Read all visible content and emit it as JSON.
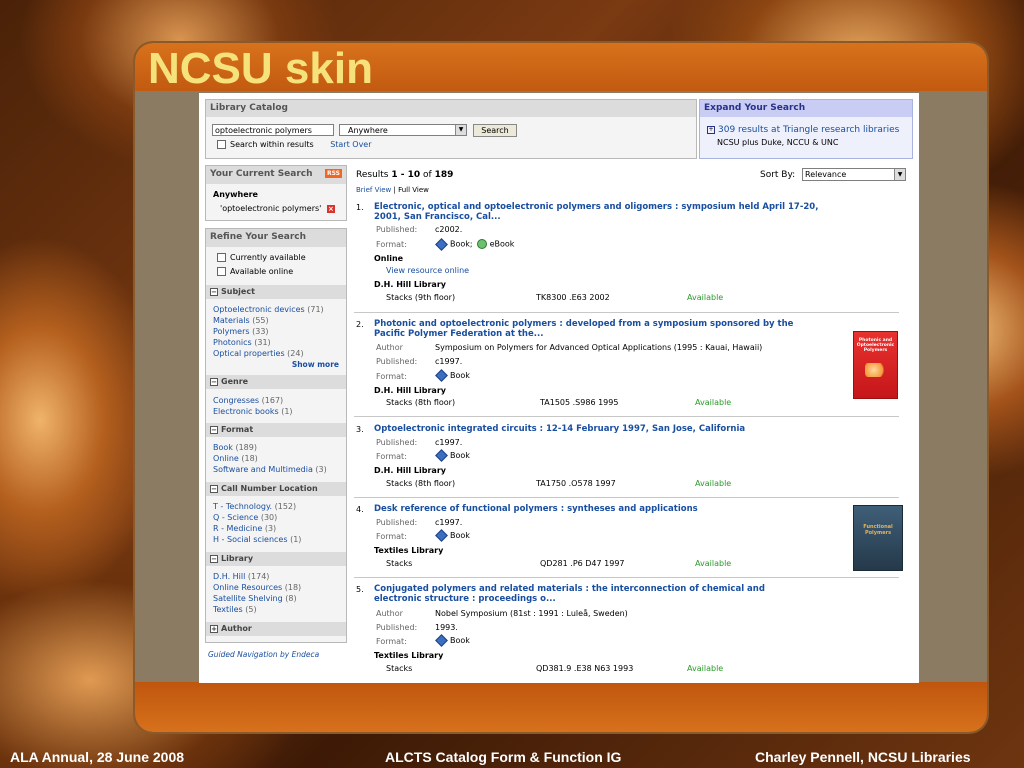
{
  "slide": {
    "title": "NCSU skin",
    "footer_left": "ALA Annual, 28 June 2008",
    "footer_center": "ALCTS Catalog Form & Function IG",
    "footer_right": "Charley Pennell, NCSU Libraries"
  },
  "catalog": {
    "header": "Library Catalog",
    "query": "optoelectronic polymers",
    "scope": "Anywhere",
    "search_label": "Search",
    "within_label": "Search within results",
    "start_over": "Start Over"
  },
  "expand": {
    "header": "Expand Your Search",
    "link": "309 results at Triangle research libraries",
    "sub": "NCSU plus Duke, NCCU & UNC"
  },
  "current": {
    "header": "Your Current Search",
    "rss": "RSS",
    "field": "Anywhere",
    "term": "'optoelectronic polymers'"
  },
  "refine": {
    "header": "Refine Your Search",
    "currently_available": "Currently available",
    "available_online": "Available online",
    "show_more": "Show more",
    "facets": [
      {
        "title": "Subject",
        "items": [
          {
            "label": "Optoelectronic devices",
            "count": "(71)"
          },
          {
            "label": "Materials",
            "count": "(55)"
          },
          {
            "label": "Polymers",
            "count": "(33)"
          },
          {
            "label": "Photonics",
            "count": "(31)"
          },
          {
            "label": "Optical properties",
            "count": "(24)"
          }
        ]
      },
      {
        "title": "Genre",
        "items": [
          {
            "label": "Congresses",
            "count": "(167)"
          },
          {
            "label": "Electronic books",
            "count": "(1)"
          }
        ]
      },
      {
        "title": "Format",
        "items": [
          {
            "label": "Book",
            "count": "(189)"
          },
          {
            "label": "Online",
            "count": "(18)"
          },
          {
            "label": "Software and Multimedia",
            "count": "(3)"
          }
        ]
      },
      {
        "title": "Call Number Location",
        "items": [
          {
            "label": "T - Technology.",
            "count": "(152)"
          },
          {
            "label": "Q - Science",
            "count": "(30)"
          },
          {
            "label": "R - Medicine",
            "count": "(3)"
          },
          {
            "label": "H - Social sciences",
            "count": "(1)"
          }
        ]
      },
      {
        "title": "Library",
        "items": [
          {
            "label": "D.H. Hill",
            "count": "(174)"
          },
          {
            "label": "Online Resources",
            "count": "(18)"
          },
          {
            "label": "Satellite Shelving",
            "count": "(8)"
          },
          {
            "label": "Textiles",
            "count": "(5)"
          }
        ]
      },
      {
        "title": "Author",
        "items": []
      }
    ],
    "endeca": "Guided Navigation by Endeca"
  },
  "results": {
    "prefix": "Results",
    "range": "1 - 10",
    "of": "of",
    "total": "189",
    "brief_view": "Brief View",
    "divider": "|",
    "full_view": "Full View",
    "sort_label": "Sort By:",
    "sort_value": "Relevance",
    "labels": {
      "published": "Published:",
      "format": "Format:",
      "author": "Author",
      "online": "Online",
      "view_online": "View resource online",
      "available": "Available"
    },
    "items": [
      {
        "num": "1.",
        "title": "Electronic, optical and optoelectronic polymers and oligomers : symposium held April 17-20, 2001, San Francisco, Cal...",
        "published": "c2002.",
        "format1": "Book;",
        "format2": "eBook",
        "library": "D.H. Hill Library",
        "location": "Stacks (9th floor)",
        "callno": "TK8300 .E63 2002"
      },
      {
        "num": "2.",
        "title": "Photonic and optoelectronic polymers : developed from a symposium sponsored by the Pacific Polymer Federation at the...",
        "author": "Symposium on Polymers for Advanced Optical Applications (1995 : Kauai, Hawaii)",
        "published": "c1997.",
        "format1": "Book",
        "library": "D.H. Hill Library",
        "location": "Stacks (8th floor)",
        "callno": "TA1505 .S986 1995",
        "cover_text": "Photonic and Optoelectronic Polymers"
      },
      {
        "num": "3.",
        "title": "Optoelectronic integrated circuits : 12-14 February 1997, San Jose, California",
        "published": "c1997.",
        "format1": "Book",
        "library": "D.H. Hill Library",
        "location": "Stacks (8th floor)",
        "callno": "TA1750 .O578 1997"
      },
      {
        "num": "4.",
        "title": "Desk reference of functional polymers : syntheses and applications",
        "published": "c1997.",
        "format1": "Book",
        "library": "Textiles Library",
        "location": "Stacks",
        "callno": "QD281 .P6 D47 1997",
        "cover_text": "Functional Polymers"
      },
      {
        "num": "5.",
        "title": "Conjugated polymers and related materials : the interconnection of chemical and electronic structure : proceedings o...",
        "author": "Nobel Symposium (81st : 1991 : Luleå, Sweden)",
        "published": "1993.",
        "format1": "Book",
        "library": "Textiles Library",
        "location": "Stacks",
        "callno": "QD381.9 .E38 N63 1993"
      }
    ]
  }
}
